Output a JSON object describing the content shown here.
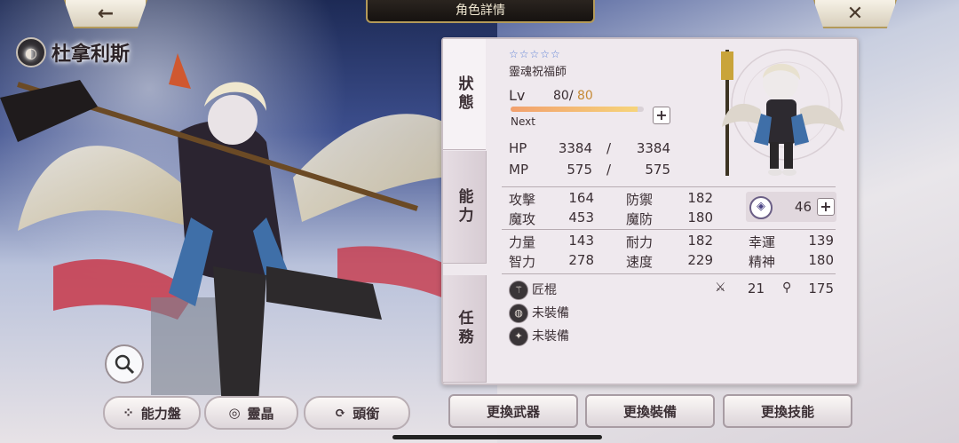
{
  "header": {
    "title": "角色詳情",
    "back_icon": "←",
    "close_icon": "✕"
  },
  "character": {
    "name": "杜拿利斯",
    "element_icon": "spirit-element",
    "stars": "☆☆☆☆☆",
    "job": "靈魂祝福師",
    "level_label": "Lv",
    "level": "80",
    "level_sep": "/",
    "level_max": "80",
    "exp_fraction": 0.95,
    "next_label": "Next"
  },
  "tabs": [
    {
      "label": "狀態"
    },
    {
      "label": "能力"
    },
    {
      "label": "任務"
    }
  ],
  "stats": {
    "hp": {
      "label": "HP",
      "current": "3384",
      "sep": "/",
      "max": "3384"
    },
    "mp": {
      "label": "MP",
      "current": "575",
      "sep": "/",
      "max": "575"
    },
    "attack": {
      "label": "攻擊",
      "value": "164"
    },
    "defense": {
      "label": "防禦",
      "value": "182"
    },
    "magic": {
      "label": "魔攻",
      "value": "453"
    },
    "magic_def": {
      "label": "魔防",
      "value": "180"
    },
    "strength": {
      "label": "力量",
      "value": "143"
    },
    "endurance": {
      "label": "耐力",
      "value": "182"
    },
    "luck": {
      "label": "幸運",
      "value": "139"
    },
    "intellect": {
      "label": "智力",
      "value": "278"
    },
    "speed": {
      "label": "速度",
      "value": "229"
    },
    "spirit": {
      "label": "精神",
      "value": "180"
    },
    "soul_value": "46"
  },
  "equipment": [
    {
      "name": "匠棍",
      "icon": "staff-icon"
    },
    {
      "name": "未裝備",
      "icon": "armor-icon"
    },
    {
      "name": "未裝備",
      "icon": "accessory-icon"
    }
  ],
  "weapon_stats": {
    "attack": "21",
    "magic": "175"
  },
  "left_buttons": [
    {
      "label": "能力盤",
      "icon": "board-icon"
    },
    {
      "label": "靈晶",
      "icon": "crystal-icon"
    },
    {
      "label": "頭銜",
      "icon": "refresh-icon"
    }
  ],
  "actions": [
    {
      "label": "更換武器"
    },
    {
      "label": "更換裝備"
    },
    {
      "label": "更換技能"
    }
  ],
  "colors": {
    "panel_bg": "#efe9ee",
    "accent_gold": "#b39a5a",
    "star_blue": "#5b7fd6",
    "level_max": "#c58a35"
  }
}
